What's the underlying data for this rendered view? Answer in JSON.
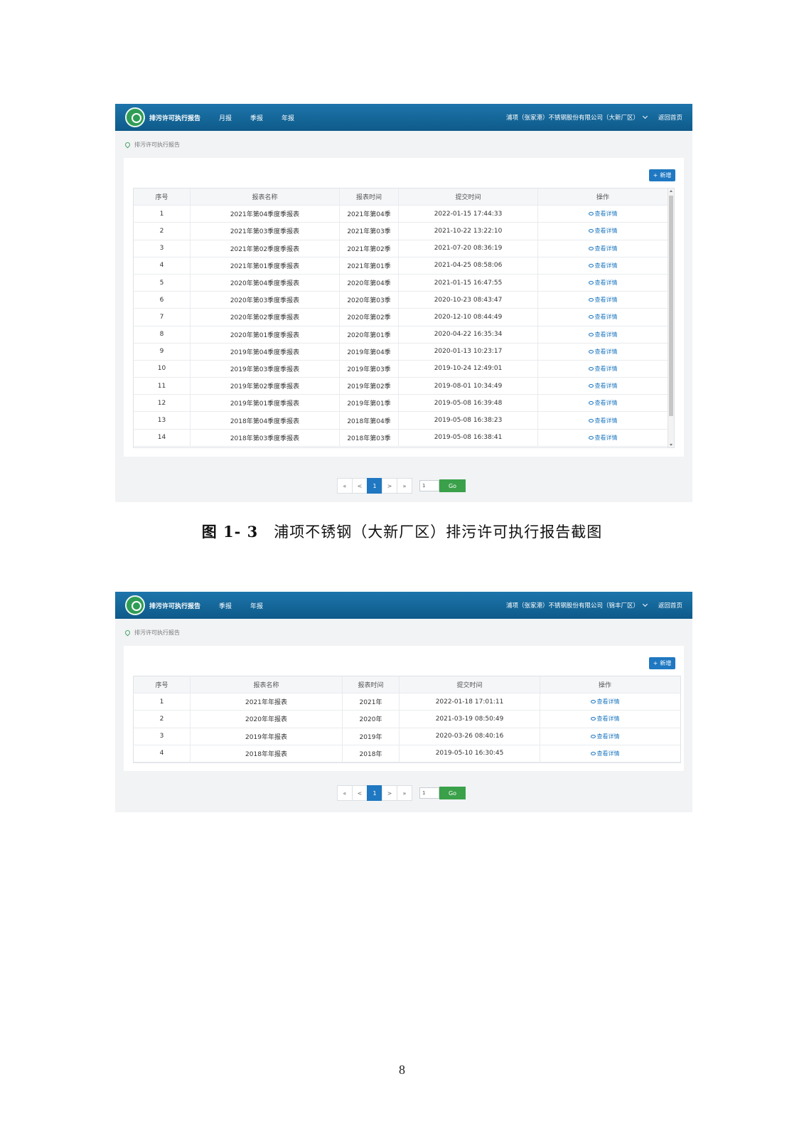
{
  "shot1": {
    "app_title": "排污许可执行报告",
    "nav": [
      "月报",
      "季报",
      "年报"
    ],
    "company": "浦项（张家港）不锈钢股份有限公司（大新厂区）",
    "home": "返回首页",
    "breadcrumb": "排污许可执行报告",
    "add_label": "新增",
    "columns": [
      "序号",
      "报表名称",
      "报表时间",
      "提交时间",
      "操作"
    ],
    "rows": [
      [
        "1",
        "2021年第04季度季报表",
        "2021年第04季",
        "2022-01-15 17:44:33",
        "查看详情"
      ],
      [
        "2",
        "2021年第03季度季报表",
        "2021年第03季",
        "2021-10-22 13:22:10",
        "查看详情"
      ],
      [
        "3",
        "2021年第02季度季报表",
        "2021年第02季",
        "2021-07-20 08:36:19",
        "查看详情"
      ],
      [
        "4",
        "2021年第01季度季报表",
        "2021年第01季",
        "2021-04-25 08:58:06",
        "查看详情"
      ],
      [
        "5",
        "2020年第04季度季报表",
        "2020年第04季",
        "2021-01-15 16:47:55",
        "查看详情"
      ],
      [
        "6",
        "2020年第03季度季报表",
        "2020年第03季",
        "2020-10-23 08:43:47",
        "查看详情"
      ],
      [
        "7",
        "2020年第02季度季报表",
        "2020年第02季",
        "2020-12-10 08:44:49",
        "查看详情"
      ],
      [
        "8",
        "2020年第01季度季报表",
        "2020年第01季",
        "2020-04-22 16:35:34",
        "查看详情"
      ],
      [
        "9",
        "2019年第04季度季报表",
        "2019年第04季",
        "2020-01-13 10:23:17",
        "查看详情"
      ],
      [
        "10",
        "2019年第03季度季报表",
        "2019年第03季",
        "2019-10-24 12:49:01",
        "查看详情"
      ],
      [
        "11",
        "2019年第02季度季报表",
        "2019年第02季",
        "2019-08-01 10:34:49",
        "查看详情"
      ],
      [
        "12",
        "2019年第01季度季报表",
        "2019年第01季",
        "2019-05-08 16:39:48",
        "查看详情"
      ],
      [
        "13",
        "2018年第04季度季报表",
        "2018年第04季",
        "2019-05-08 16:38:23",
        "查看详情"
      ],
      [
        "14",
        "2018年第03季度季报表",
        "2018年第03季",
        "2019-05-08 16:38:41",
        "查看详情"
      ]
    ],
    "pager": {
      "first": "«",
      "prev": "<",
      "current": "1",
      "next": ">",
      "last": "»",
      "input_value": "1",
      "go_label": "Go"
    }
  },
  "caption": {
    "number": "图 1- 3",
    "text": "浦项不锈钢（大新厂区）排污许可执行报告截图"
  },
  "shot2": {
    "app_title": "排污许可执行报告",
    "nav": [
      "季报",
      "年报"
    ],
    "company": "浦项（张家港）不锈钢股份有限公司（锦丰厂区）",
    "home": "返回首页",
    "breadcrumb": "排污许可执行报告",
    "add_label": "新增",
    "columns": [
      "序号",
      "报表名称",
      "报表时间",
      "提交时间",
      "操作"
    ],
    "rows": [
      [
        "1",
        "2021年年报表",
        "2021年",
        "2022-01-18 17:01:11",
        "查看详情"
      ],
      [
        "2",
        "2020年年报表",
        "2020年",
        "2021-03-19 08:50:49",
        "查看详情"
      ],
      [
        "3",
        "2019年年报表",
        "2019年",
        "2020-03-26 08:40:16",
        "查看详情"
      ],
      [
        "4",
        "2018年年报表",
        "2018年",
        "2019-05-10 16:30:45",
        "查看详情"
      ]
    ],
    "pager": {
      "first": "«",
      "prev": "<",
      "current": "1",
      "next": ">",
      "last": "»",
      "input_value": "1",
      "go_label": "Go"
    }
  },
  "page_number": "8"
}
